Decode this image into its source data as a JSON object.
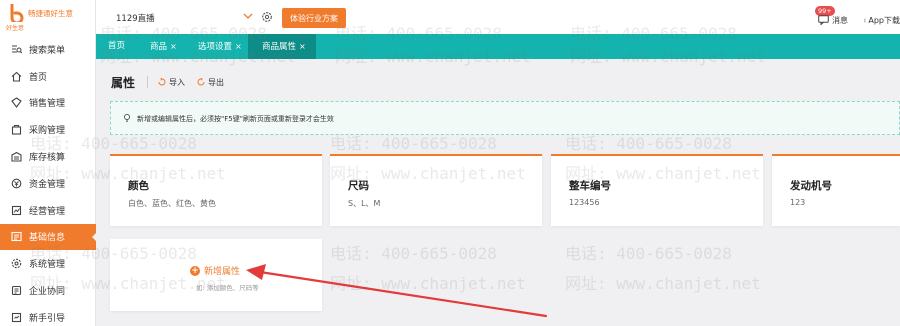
{
  "sidebar": {
    "logo_name": "畅捷通好生意",
    "logo_sub": "好生意",
    "items": [
      {
        "label": "搜索菜单",
        "icon": "search-menu-icon"
      },
      {
        "label": "首页",
        "icon": "home-icon"
      },
      {
        "label": "销售管理",
        "icon": "sales-icon"
      },
      {
        "label": "采购管理",
        "icon": "purchase-icon"
      },
      {
        "label": "库存核算",
        "icon": "inventory-icon"
      },
      {
        "label": "资金管理",
        "icon": "funds-icon"
      },
      {
        "label": "经营管理",
        "icon": "business-icon"
      },
      {
        "label": "基础信息",
        "icon": "basic-info-icon",
        "active": true
      },
      {
        "label": "系统管理",
        "icon": "system-icon"
      },
      {
        "label": "企业协同",
        "icon": "collaboration-icon"
      },
      {
        "label": "新手引导",
        "icon": "guide-icon"
      }
    ]
  },
  "topbar": {
    "shop_name": "1129直播",
    "trial_button": "体验行业方案",
    "messages_label": "消息",
    "messages_badge": "99+",
    "app_download": "App下载"
  },
  "tabs": [
    {
      "label": "首页",
      "closable": false
    },
    {
      "label": "商品",
      "closable": true
    },
    {
      "label": "选项设置",
      "closable": true
    },
    {
      "label": "商品属性",
      "closable": true,
      "active": true
    }
  ],
  "page": {
    "title": "属性",
    "import_label": "导入",
    "export_label": "导出",
    "notice": "新增或编辑属性后，必须按\"F5键\"刷新页面或重新登录才会生效"
  },
  "attributes": [
    {
      "name": "颜色",
      "values": "白色、蓝色、红色、黄色"
    },
    {
      "name": "尺码",
      "values": "S、L、M"
    },
    {
      "name": "整车编号",
      "values": "123456"
    },
    {
      "name": "发动机号",
      "values": "123"
    }
  ],
  "add_card": {
    "button_label": "新增属性",
    "hint": "如: 添加颜色、尺码等"
  },
  "watermark": {
    "phone": "电话: 400-665-0028",
    "site": "网址: www.chanjet.net"
  },
  "colors": {
    "accent": "#f07b2c",
    "tabbar": "#14b3ad",
    "tab_active": "#0e8d88",
    "annotation_arrow": "#e33a3a"
  }
}
